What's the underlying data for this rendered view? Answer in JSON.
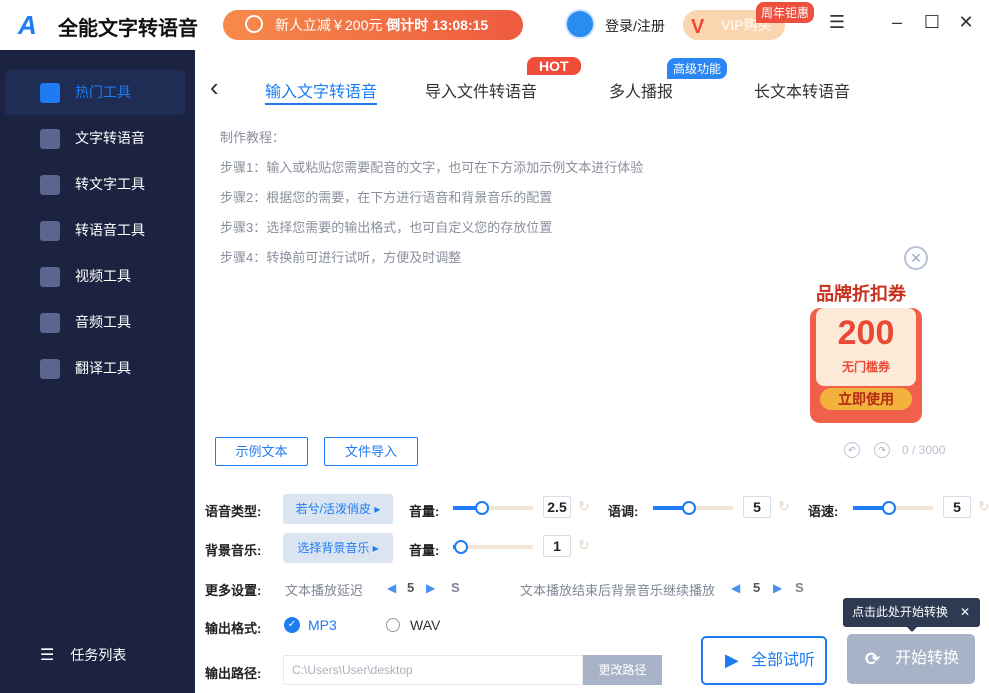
{
  "app": {
    "logo": "A",
    "name": "全能文字转语音"
  },
  "promo": {
    "text": "新人立减￥200元",
    "countdown_label": "倒计时",
    "countdown": "13:08:15"
  },
  "user": {
    "login": "登录/注册"
  },
  "vip": {
    "label": "VIP购买",
    "badge": "周年钜惠"
  },
  "window": {
    "menu": "☰",
    "minimize": "–",
    "maximize": "☐",
    "close": "✕"
  },
  "sidebar": {
    "items": [
      {
        "label": "热门工具"
      },
      {
        "label": "文字转语音"
      },
      {
        "label": "转文字工具"
      },
      {
        "label": "转语音工具"
      },
      {
        "label": "视频工具"
      },
      {
        "label": "音频工具"
      },
      {
        "label": "翻译工具"
      }
    ],
    "task_list": "任务列表"
  },
  "tabs": {
    "back": "‹",
    "items": [
      {
        "label": "输入文字转语音"
      },
      {
        "label": "导入文件转语音"
      },
      {
        "label": "多人播报"
      },
      {
        "label": "长文本转语音"
      }
    ],
    "hot_badge": "HOT",
    "adv_badge": "高级功能"
  },
  "tutorial": {
    "title": "制作教程：",
    "steps": [
      "步骤1：输入或粘贴您需要配音的文字，也可在下方添加示例文本进行体验",
      "步骤2：根据您的需要，在下方进行语音和背景音乐的配置",
      "步骤3：选择您需要的输出格式，也可自定义您的存放位置",
      "步骤4：转换前可进行试听，方便及时调整"
    ]
  },
  "editor": {
    "sample_btn": "示例文本",
    "import_btn": "文件导入",
    "counter": "0 / 3000"
  },
  "coupon": {
    "title": "品牌折扣券",
    "amount": "200",
    "subtitle": "无门槛券",
    "use": "立即使用",
    "close": "✕"
  },
  "settings": {
    "voice_type_label": "语音类型:",
    "voice": "若兮/活泼俏皮",
    "volume_label": "音量:",
    "volume": "2.5",
    "volume_pct": 36,
    "pitch_label": "语调:",
    "pitch": "5",
    "pitch_pct": 45,
    "speed_label": "语速:",
    "speed": "5",
    "speed_pct": 45,
    "bgm_label": "背景音乐:",
    "bgm": "选择背景音乐",
    "bgm_volume_label": "音量:",
    "bgm_volume": "1",
    "bgm_volume_pct": 10,
    "more_label": "更多设置:",
    "delay_label": "文本播放延迟",
    "delay": "5",
    "delay_unit": "S",
    "continue_label": "文本播放结束后背景音乐继续播放",
    "continue": "5",
    "continue_unit": "S",
    "format_label": "输出格式:",
    "formats": [
      "MP3",
      "WAV"
    ],
    "selected_format": "MP3",
    "path_label": "输出路径:",
    "path": "C:\\Users\\User\\desktop",
    "change_path": "更改路径"
  },
  "actions": {
    "preview": "全部试听",
    "start": "开始转换",
    "tooltip": "点击此处开始转换",
    "tooltip_close": "✕"
  },
  "colors": {
    "accent": "#1e7cf2",
    "sidebar": "#1b2340",
    "hot": "#ef4c3a"
  }
}
